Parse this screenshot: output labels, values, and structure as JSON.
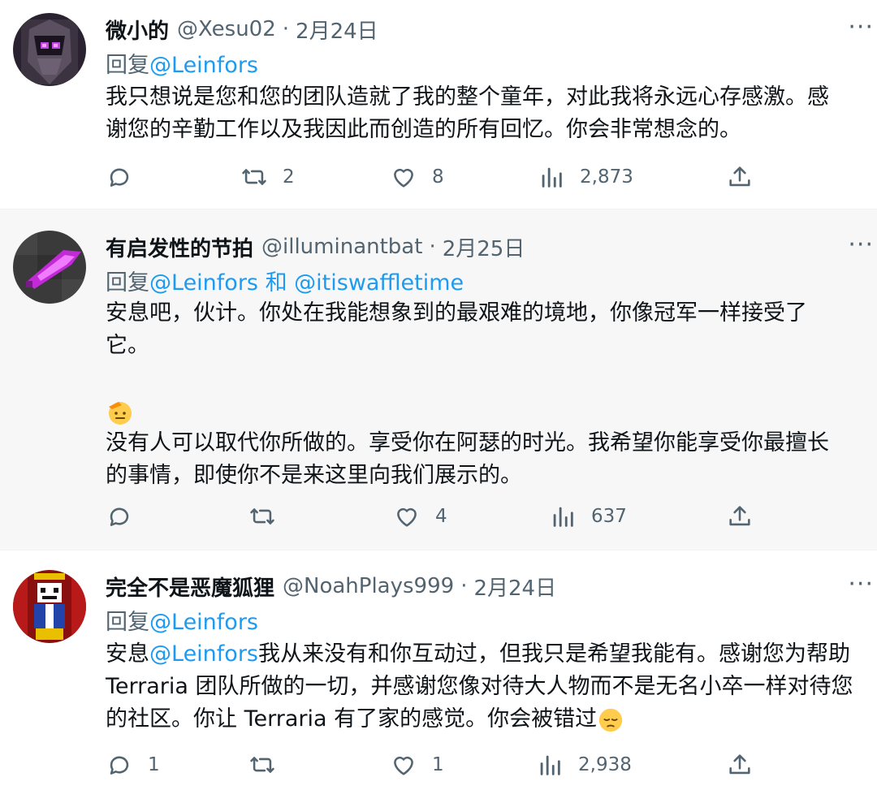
{
  "tweets": [
    {
      "display_name": "微小的",
      "handle": "@Xesu02",
      "separator": "·",
      "date": "2月24日",
      "reply_prefix": "回复",
      "reply_to": "@Leinfors",
      "body_lines": [
        "我只想说是您和您的团队造就了我的整个童年，对此我将永远心存感激。感",
        "谢您的辛勤工作以及我因此而创造的所有回忆。你会非常想念的。"
      ],
      "retweets": "2",
      "likes": "8",
      "views": "2,873"
    },
    {
      "display_name": "有启发性的节拍",
      "handle": "@illuminantbat",
      "separator": "·",
      "date": "2月25日",
      "reply_prefix": "回复",
      "reply_to": "@Leinfors",
      "reply_and": " 和 ",
      "reply_to_2": "@itiswaffletime",
      "body_lines": [
        "安息吧，伙计。你处在我能想象到的最艰难的境地，你像冠军一样接受了",
        "它。"
      ],
      "body_lines_2": [
        "没有人可以取代你所做的。享受你在阿瑟的时光。我希望你能享受你最擅长",
        "的事情，即使你不是来这里向我们展示的。"
      ],
      "likes": "4",
      "views": "637"
    },
    {
      "display_name": "完全不是恶魔狐狸",
      "handle": "@NoahPlays999",
      "separator": "·",
      "date": "2月24日",
      "reply_prefix": "回复",
      "reply_to": "@Leinfors",
      "body_line1_start": "安息",
      "body_line1_mention": "@Leinfors",
      "body_line1_end": "我从来没有和你互动过，但我只是希望我能有。感谢您为帮助",
      "body_line2": "Terraria 团队所做的一切，并感谢您像对待大人物而不是无名小卒一样对待您",
      "body_line3": "的社区。你让 Terraria 有了家的感觉。你会被错过",
      "replies": "1",
      "likes": "1",
      "views": "2,938"
    }
  ],
  "more_label": "···",
  "colors": {
    "link": "#1d9bf0",
    "muted": "#536471",
    "text": "#0f1419",
    "highlight_bg": "#f7f7f7"
  },
  "icons": [
    "reply-icon",
    "retweet-icon",
    "like-icon",
    "views-icon",
    "share-icon",
    "more-icon"
  ]
}
